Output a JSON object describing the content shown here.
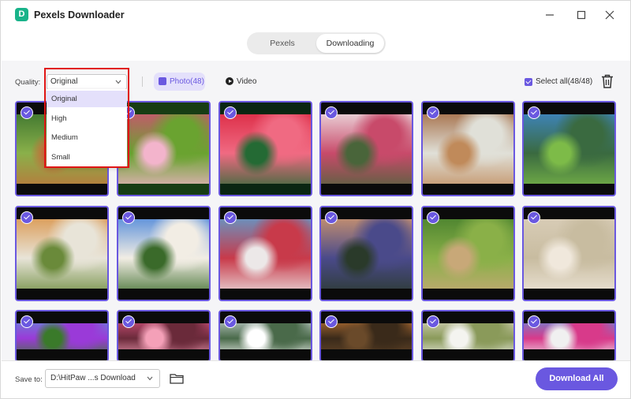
{
  "window": {
    "title": "Pexels Downloader",
    "logo_letter": "D"
  },
  "tabs": [
    {
      "label": "Pexels",
      "active": false
    },
    {
      "label": "Downloading",
      "active": true
    }
  ],
  "filters": {
    "quality_label": "Quality:",
    "quality_value": "Original",
    "quality_options": [
      "Original",
      "High",
      "Medium",
      "Small"
    ],
    "photo_label": "Photo(48)",
    "video_label": "Video",
    "select_all_label": "Select all(48/48)"
  },
  "grid": {
    "tiles": [
      {
        "subject": "forest-path",
        "colors": [
          "#0b0b0b",
          "#2f6a2a",
          "#8ab04a",
          "#c0703a"
        ],
        "checked": true
      },
      {
        "subject": "pink-flowers",
        "colors": [
          "#173d14",
          "#d8487a",
          "#6aa330",
          "#f3b4cc"
        ],
        "checked": true
      },
      {
        "subject": "red-rose",
        "colors": [
          "#0a2612",
          "#d8203a",
          "#f06a82",
          "#246a34"
        ],
        "checked": true
      },
      {
        "subject": "house-arch",
        "colors": [
          "#0b0b0b",
          "#f2f2f2",
          "#c84a6a",
          "#49653a"
        ],
        "checked": true
      },
      {
        "subject": "wooden-bench",
        "colors": [
          "#0b0b0b",
          "#9a5a2e",
          "#e0e0d8",
          "#c08a5a"
        ],
        "checked": true
      },
      {
        "subject": "mountain-meadow",
        "colors": [
          "#0b0b0b",
          "#3f8ad8",
          "#3a6a40",
          "#7dbb48"
        ],
        "checked": true
      },
      {
        "subject": "woman-portrait",
        "colors": [
          "#0b0b0b",
          "#d88b3a",
          "#e8e4d8",
          "#6a8a3a"
        ],
        "checked": true
      },
      {
        "subject": "pagoda-house",
        "colors": [
          "#0b0b0b",
          "#3a7bd8",
          "#f2ede4",
          "#3a6a2a"
        ],
        "checked": true
      },
      {
        "subject": "tulip-field",
        "colors": [
          "#0b0b0b",
          "#52a8dc",
          "#c83a4a",
          "#ece8e8"
        ],
        "checked": true
      },
      {
        "subject": "misty-field",
        "colors": [
          "#0b0b0b",
          "#e0a06a",
          "#4a4a8a",
          "#2a3a2a"
        ],
        "checked": true
      },
      {
        "subject": "small-bird",
        "colors": [
          "#0b0b0b",
          "#3f7a2a",
          "#8ab048",
          "#c8a878"
        ],
        "checked": true
      },
      {
        "subject": "blurred-grass",
        "colors": [
          "#0b0b0b",
          "#dcd0bc",
          "#c8bca0",
          "#f0e8dc"
        ],
        "checked": true
      },
      {
        "subject": "purple-flowers",
        "colors": [
          "#0b0b0b",
          "#5a9ad8",
          "#9a3ad8",
          "#3a7a2a"
        ],
        "checked": true
      },
      {
        "subject": "bleeding-hearts",
        "colors": [
          "#0b0b0b",
          "#e85a8a",
          "#6a2a3a",
          "#f4a0b8"
        ],
        "checked": true
      },
      {
        "subject": "building-side",
        "colors": [
          "#0b0b0b",
          "#dfe6ec",
          "#4a6a4a",
          "#ffffff"
        ],
        "checked": true
      },
      {
        "subject": "glass-bokeh",
        "colors": [
          "#0b0b0b",
          "#d8843a",
          "#3a2a1a",
          "#6a4a2a"
        ],
        "checked": true
      },
      {
        "subject": "daisies",
        "colors": [
          "#0b0b0b",
          "#e8e0d0",
          "#8a9a5a",
          "#f4f4f0"
        ],
        "checked": true
      },
      {
        "subject": "bougainvillea-house",
        "colors": [
          "#0b0b0b",
          "#4a9ae8",
          "#d83a8a",
          "#f0f0f0"
        ],
        "checked": true
      }
    ]
  },
  "footer": {
    "save_label": "Save to:",
    "save_path": "D:\\HitPaw ...s Download",
    "download_all_label": "Download All"
  },
  "colors": {
    "accent": "#6a58e0",
    "accent_light": "#e4e0fb",
    "brand_green": "#19b38a",
    "highlight_red": "#e01515"
  }
}
